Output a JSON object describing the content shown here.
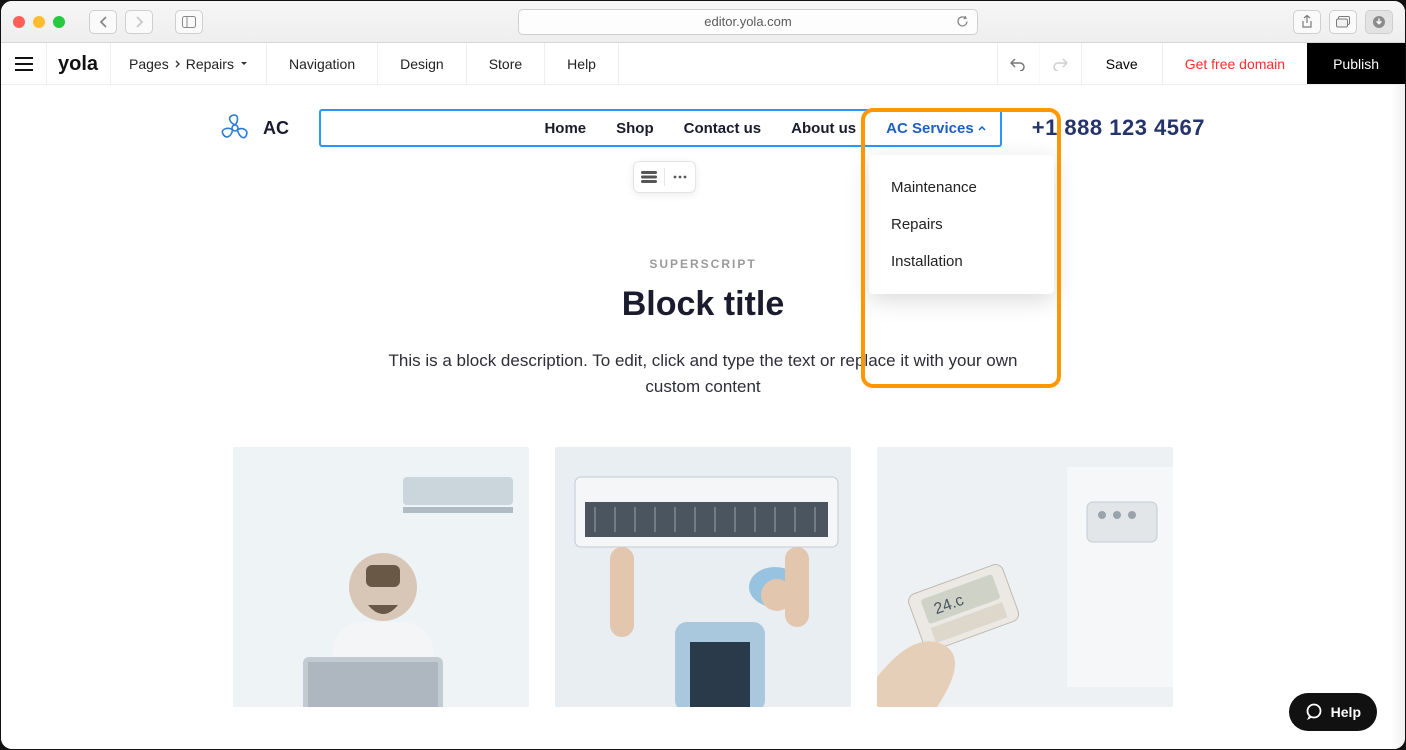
{
  "browser": {
    "url": "editor.yola.com"
  },
  "toolbar": {
    "pages_label": "Pages",
    "current_page": "Repairs",
    "items": {
      "navigation": "Navigation",
      "design": "Design",
      "store": "Store",
      "help": "Help"
    },
    "save": "Save",
    "get_domain": "Get free domain",
    "publish": "Publish"
  },
  "site": {
    "brand": "AC",
    "nav": {
      "home": "Home",
      "shop": "Shop",
      "contact": "Contact us",
      "about": "About us",
      "services": "AC Services"
    },
    "phone": "+1 888 123 4567",
    "dropdown": {
      "item1": "Maintenance",
      "item2": "Repairs",
      "item3": "Installation"
    },
    "block": {
      "superscript": "SUPERSCRIPT",
      "title": "Block title",
      "description": "This is a block description. To edit, click and type the text or replace it with your own custom content"
    }
  },
  "help_widget": "Help"
}
